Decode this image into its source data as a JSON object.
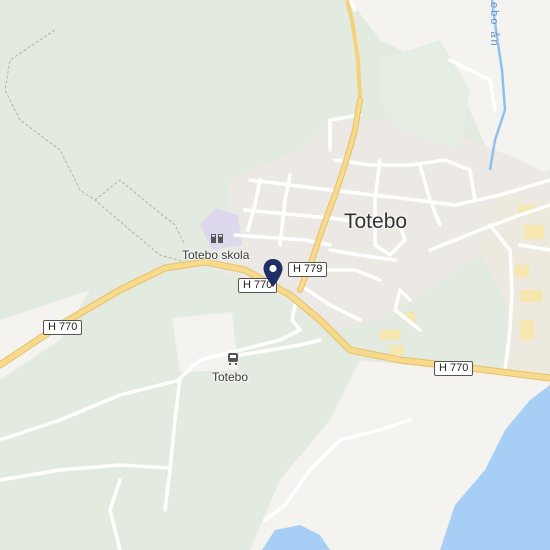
{
  "map": {
    "place_label": "Totebo",
    "school_label": "Totebo skola",
    "station_label": "Totebo",
    "river_label": "ebo ån",
    "road_labels": {
      "h770_west": "H 770",
      "h770_center": "H 770",
      "h779": "H 779",
      "h770_east": "H 770"
    },
    "icons": {
      "school": "school-icon",
      "station": "train-station-icon",
      "marker": "location-pin-icon"
    },
    "colors": {
      "forest": "#e3ebe0",
      "open_land": "#f4f3ef",
      "built_area": "#ece8e3",
      "water": "#a7cef5",
      "main_road": "#f5d27a",
      "minor_road": "#ffffff",
      "marker": "#1f2f66"
    }
  }
}
